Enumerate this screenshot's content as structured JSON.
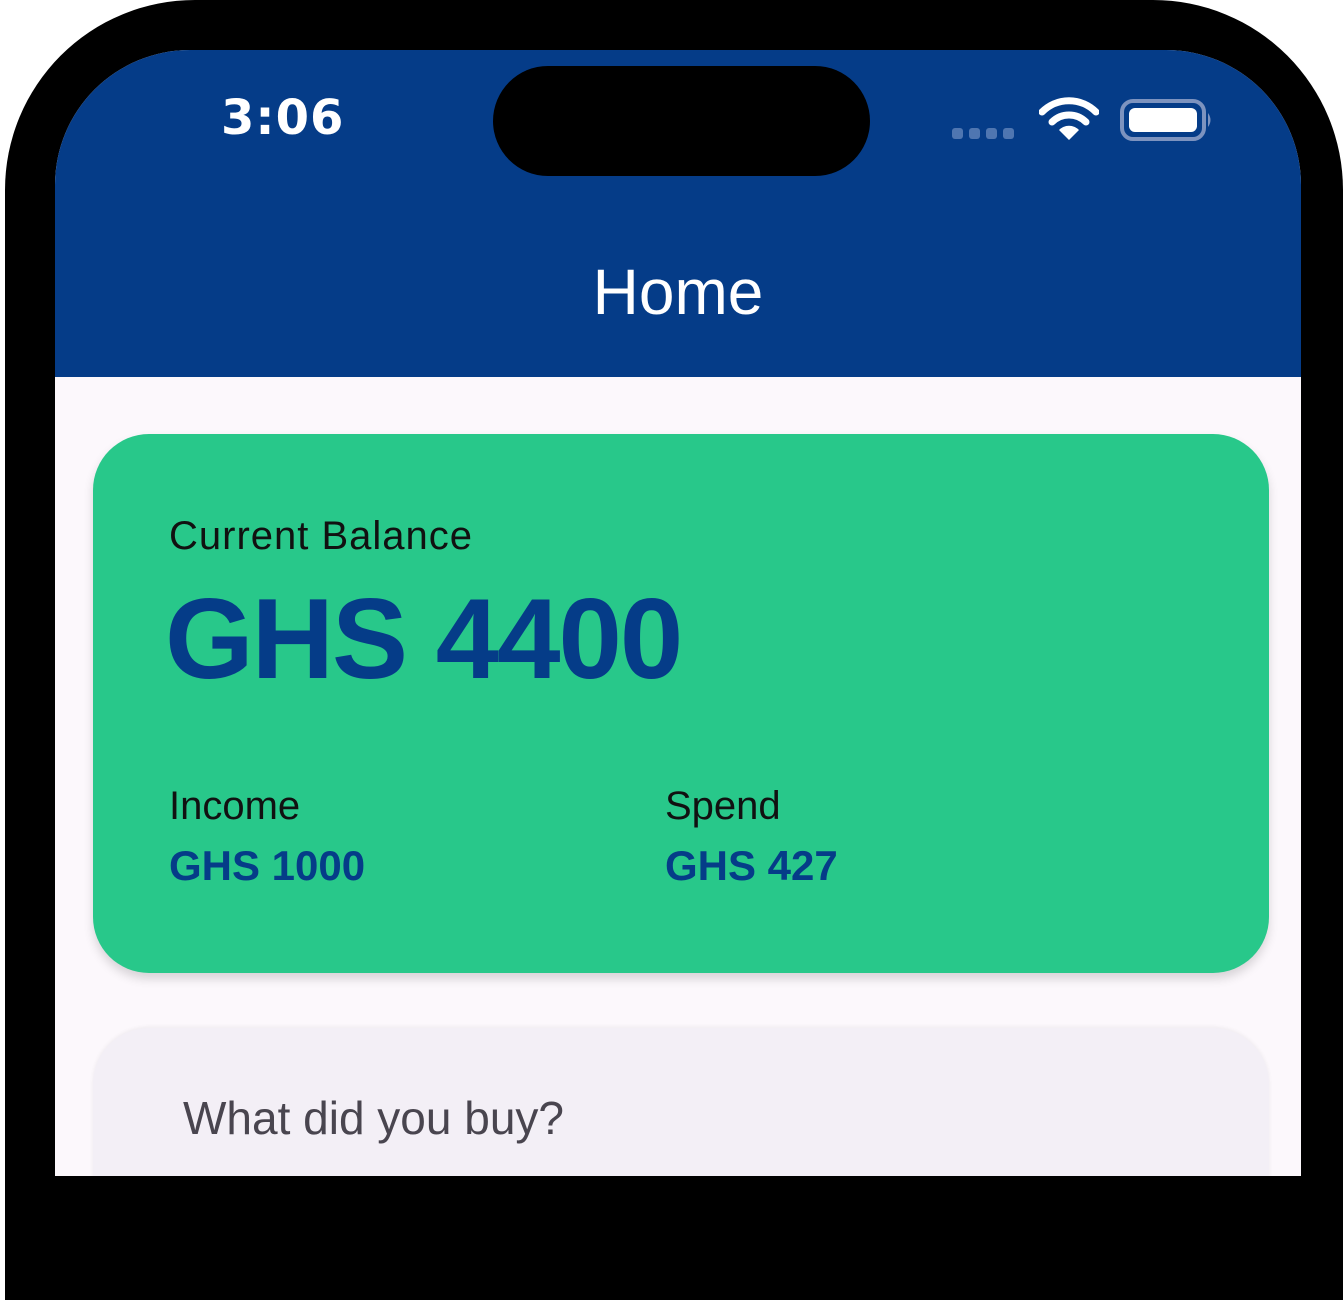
{
  "status_bar": {
    "time": "3:06",
    "icons": [
      "signal-dots-icon",
      "wifi-icon",
      "battery-icon"
    ]
  },
  "app_bar": {
    "title": "Home",
    "color": "#053c88"
  },
  "balance_card": {
    "color": "#28c88a",
    "label": "Current Balance",
    "value": "GHS 4400",
    "income": {
      "label": "Income",
      "value": "GHS 1000"
    },
    "spend": {
      "label": "Spend",
      "value": "GHS 427"
    }
  },
  "purchase_form": {
    "placeholder": "What did you buy?"
  }
}
